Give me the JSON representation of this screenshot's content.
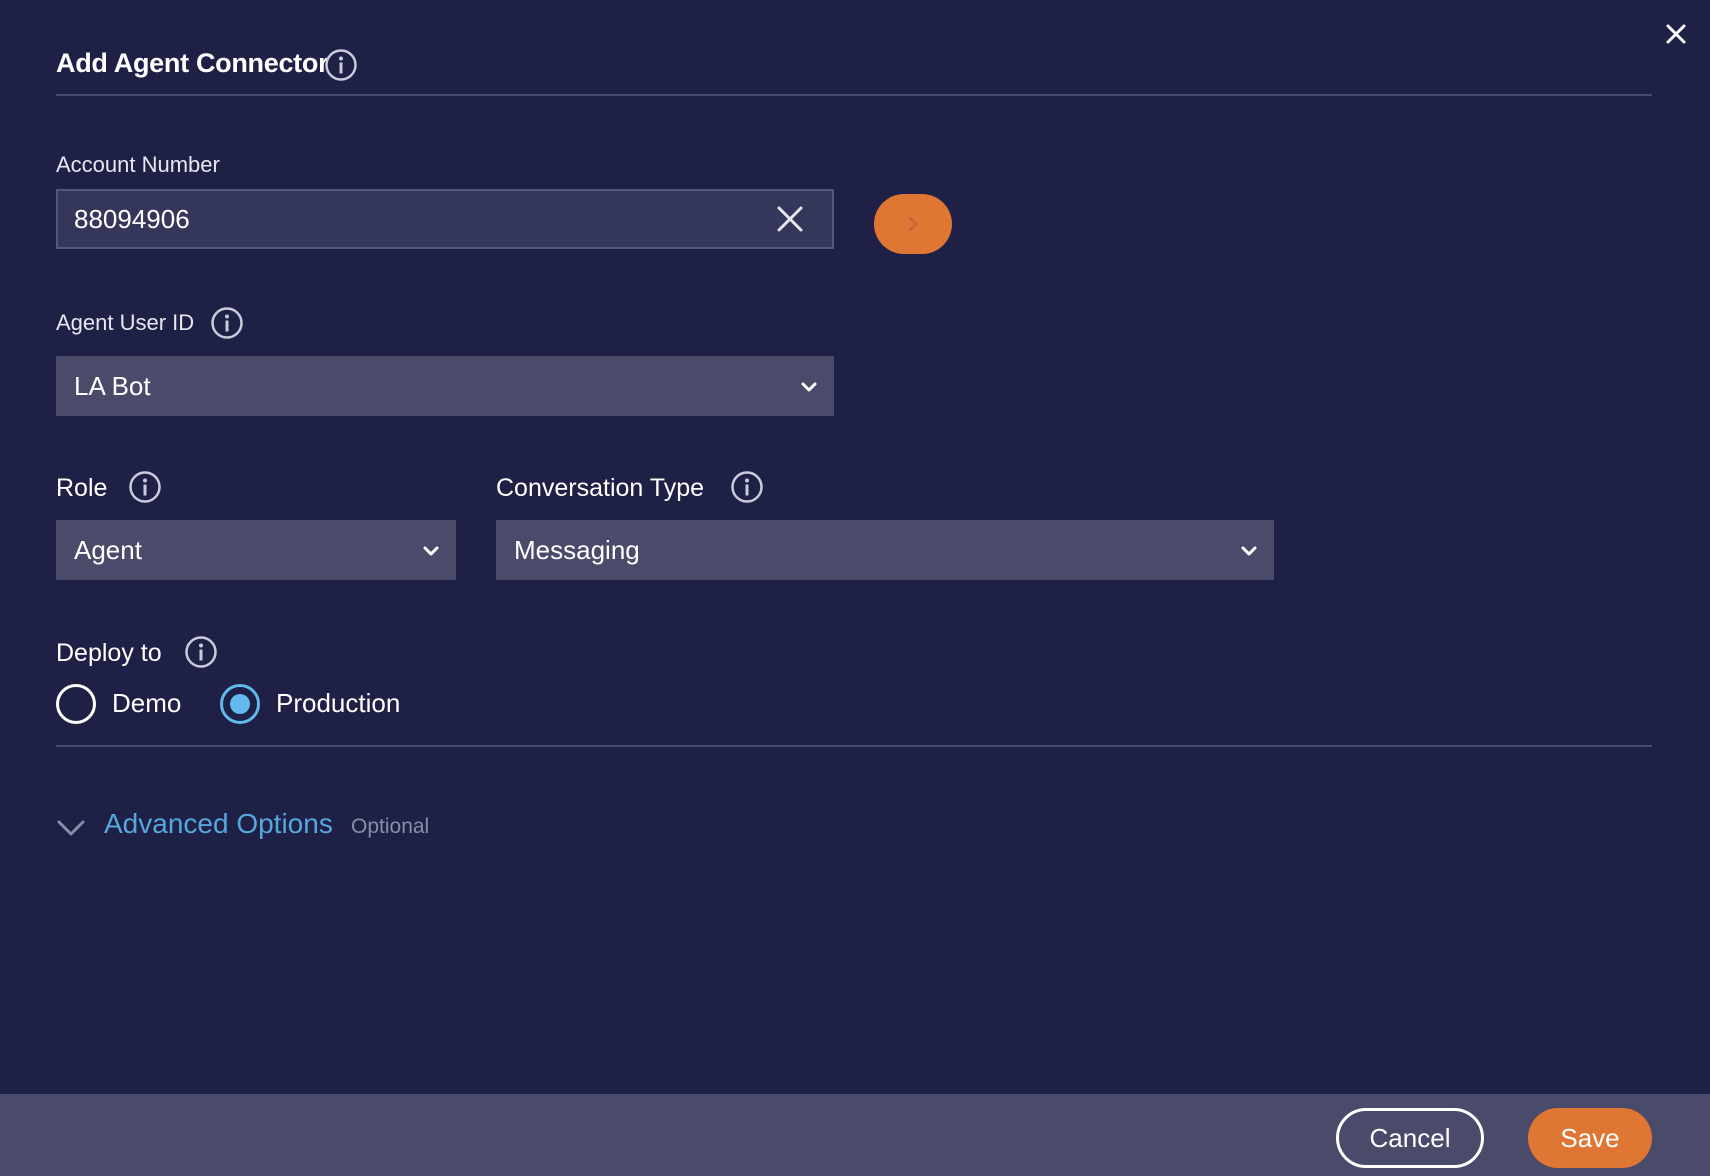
{
  "dialog": {
    "title": "Add Agent Connector",
    "close_icon": "close-icon"
  },
  "account_number": {
    "label": "Account Number",
    "value": "88094906",
    "clear_icon": "clear-icon",
    "go_icon": "chevron-right-icon"
  },
  "agent_user_id": {
    "label": "Agent User ID",
    "selected": "LA Bot"
  },
  "role": {
    "label": "Role",
    "selected": "Agent"
  },
  "conversation_type": {
    "label": "Conversation Type",
    "selected": "Messaging"
  },
  "deploy_to": {
    "label": "Deploy to",
    "options": [
      {
        "label": "Demo",
        "checked": false
      },
      {
        "label": "Production",
        "checked": true
      }
    ]
  },
  "advanced_options": {
    "label": "Advanced Options",
    "hint": "Optional"
  },
  "footer": {
    "cancel_label": "Cancel",
    "save_label": "Save"
  },
  "colors": {
    "background": "#1e2045",
    "accent": "#e07634",
    "link": "#55a7dc",
    "radio_checked": "#63b9ee"
  }
}
